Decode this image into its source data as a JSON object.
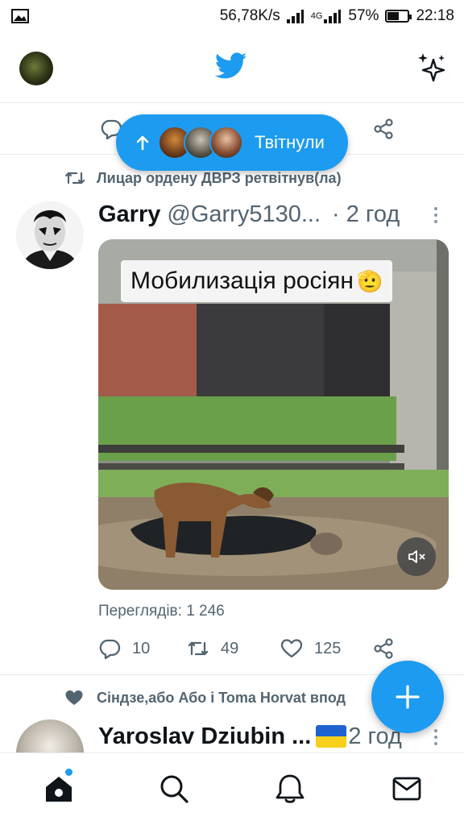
{
  "status_bar": {
    "network_speed": "56,78K/s",
    "network_type": "4G",
    "battery": "57%",
    "battery_level": 0.57,
    "time": "22:18"
  },
  "top_bar": {
    "left_icon": "profile-avatar",
    "center_icon": "twitter-bird-icon",
    "right_icon": "sparkle-icon"
  },
  "pill": {
    "label": "Твітнули"
  },
  "tweet": {
    "retweet_context": "Лицар ордену ДВРЗ ретвітнув(ла)",
    "name": "Garry",
    "handle": "@Garry5130...",
    "time": "· 2 год",
    "media_caption": "Мобилизація росіян",
    "media_caption_emoji": "🫡",
    "views": "Переглядів: 1 246",
    "replies": "10",
    "retweets": "49",
    "likes": "125"
  },
  "tweet2": {
    "like_context": "Сіндзе,або Або і Toma Horvat впод",
    "name": "Yaroslav Dziubin ...",
    "time": "2 год"
  },
  "colors": {
    "accent": "#1d9bf0",
    "secondary_text": "#536471",
    "primary_text": "#0f1419",
    "divider": "#e6ecf0"
  }
}
